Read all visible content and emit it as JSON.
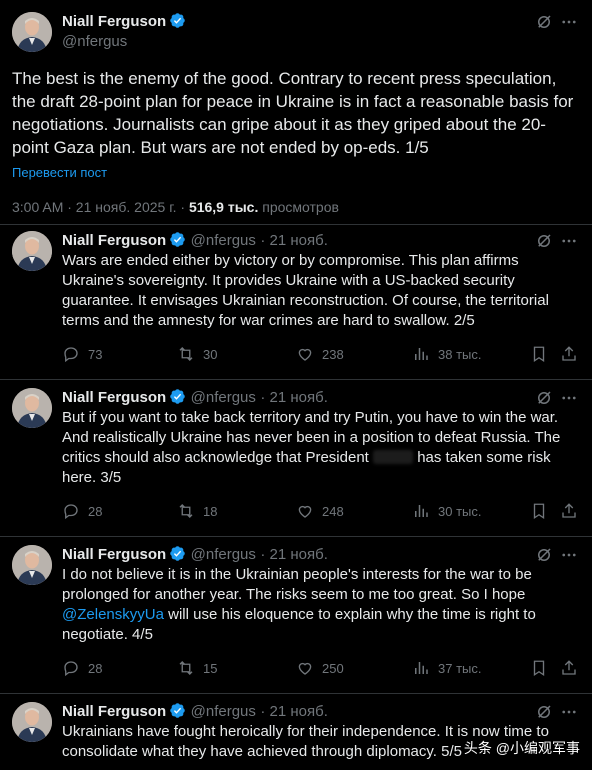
{
  "main_tweet": {
    "author_name": "Niall Ferguson",
    "handle": "@nfergus",
    "text": "The best is the enemy of the good. Contrary to recent press speculation, the draft 28-point plan for peace in Ukraine is in fact a reasonable basis for negotiations. Journalists can gripe about it as they griped about the 20-point Gaza plan. But wars are not ended by op-eds. 1/5",
    "translate_label": "Перевести пост",
    "time": "3:00 AM · 21 нояб. 2025 г. ·",
    "views_count": "516,9 тыс.",
    "views_label": "просмотров"
  },
  "replies": [
    {
      "author_name": "Niall Ferguson",
      "handle": "@nfergus",
      "date": "· 21 нояб.",
      "text": "Wars are ended either by victory or by compromise. This plan affirms Ukraine's sovereignty. It provides Ukraine with a US-backed security guarantee. It envisages Ukrainian reconstruction. Of course, the territorial terms and the amnesty for war crimes are hard to swallow. 2/5",
      "replies": "73",
      "reposts": "30",
      "likes": "238",
      "views": "38 тыс."
    },
    {
      "author_name": "Niall Ferguson",
      "handle": "@nfergus",
      "date": "· 21 нояб.",
      "text_before": "But if you want to take back territory and try Putin, you have to win the war. And realistically Ukraine has never been in a position to defeat Russia. The critics should also acknowledge that President",
      "text_after": "has taken some risk here. 3/5",
      "replies": "28",
      "reposts": "18",
      "likes": "248",
      "views": "30 тыс."
    },
    {
      "author_name": "Niall Ferguson",
      "handle": "@nfergus",
      "date": "· 21 нояб.",
      "text_before": "I do not believe it is in the Ukrainian people's interests for the war to be prolonged for another year. The risks seem to me too great. So I hope ",
      "mention": "@ZelenskyyUa",
      "text_after": " will use his eloquence to explain why the time is right to negotiate. 4/5",
      "replies": "28",
      "reposts": "15",
      "likes": "250",
      "views": "37 тыс."
    },
    {
      "author_name": "Niall Ferguson",
      "handle": "@nfergus",
      "date": "· 21 нояб.",
      "text": "Ukrainians have fought heroically for their independence. It is now time to consolidate what they have achieved through diplomacy. 5/5"
    }
  ],
  "watermark": "头条 @小编观军事",
  "colors": {
    "accent": "#1d9bf0",
    "muted": "#71767b",
    "background": "#000000"
  }
}
